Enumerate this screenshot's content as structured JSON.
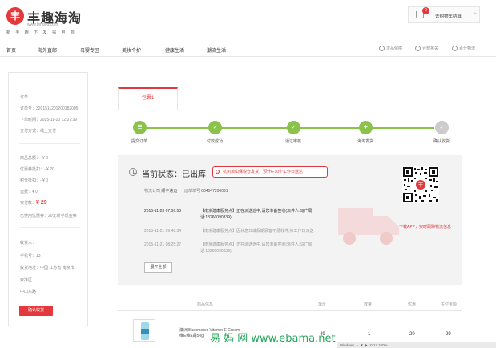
{
  "header": {
    "logo_char": "丰",
    "logo_text": "丰趣海淘",
    "logo_url": "www.fengqu.com",
    "slogan": "新 丰 趣 下 发 揭 电 商",
    "cart_count": "0",
    "cart_label": "去购物车结算",
    "cart_arrow": ">"
  },
  "nav": {
    "items": [
      "首页",
      "海外直邮",
      "母婴专区",
      "美妆个护",
      "健康生活",
      "潮流生活"
    ],
    "services": [
      "正品保障",
      "合规报关",
      "百分物流"
    ]
  },
  "sidebar": {
    "order_label": "订单",
    "order_no": "订单号：3201511201200182005",
    "order_time": "下单时间：2015-11-20 12:07:39",
    "pay_method": "支付方式：线上支付",
    "goods_total": "商品总额：- ¥ 0",
    "discount": "优惠券抵扣：- ¥ 20",
    "points": "积分抵扣：- ¥ 0",
    "freight": "运费：¥ 0",
    "paid_label": "实付款：",
    "paid_value": "¥ 29",
    "coupon": "已使用优惠券：20元新手现金券",
    "receiver": "收货人：",
    "phone": "手机号：13",
    "address": "收货地址：中国 江苏省 南京市",
    "district": "秦淮区",
    "zip": "中山东路",
    "confirm_button": "确认收货"
  },
  "main": {
    "tab_label": "包裹1",
    "steps": [
      "提交订单",
      "付款成功",
      "通过审核",
      "海淘发货",
      "确认收货"
    ],
    "status_title": "当前状态：已出库",
    "tip": "杭州萧山保税仓发货，预计6-10个工作日送达",
    "carrier_label": "物流公司",
    "carrier": "顺丰速运",
    "waybill_label": "运单单号",
    "waybill": "604047200091",
    "events": [
      {
        "time": "2015-11-23 07:06:58",
        "desc": "【南京建康服务点】正在派送途中,请您准备签收(派件人:马广局",
        "desc2": "话:18260090339)"
      },
      {
        "time": "2015-11-21 09:48:34",
        "desc": "【南京建康服务点】因休息日或假期顾客不便收件,待工作日派送",
        "desc2": ""
      },
      {
        "time": "2015-11-21 08:25:27",
        "desc": "【南京建康服务点】正在派送途中,请您准备签收(派件人:马广局",
        "desc2": "话:18260090339)"
      }
    ],
    "expand_button": "展开全部",
    "qr_caption": "下载APP，实时跟踪物流信息",
    "table_headers": [
      "商品信息",
      "单价",
      "数量",
      "优惠",
      "实付金额"
    ],
    "product": {
      "name": "澳洲Blackmores Vitamin E Cream维E维E霜50g",
      "price": "49",
      "qty": "1",
      "discount": "20",
      "paid": "29"
    }
  },
  "watermark": "易 妈 网  www.ebama.net",
  "statusbar": "Windows  ▲  ▼  ◆  10:12  100%",
  "colors": {
    "accent": "#e4393c",
    "step_green": "#8bc34a",
    "watermark_green": "#26a65b"
  }
}
